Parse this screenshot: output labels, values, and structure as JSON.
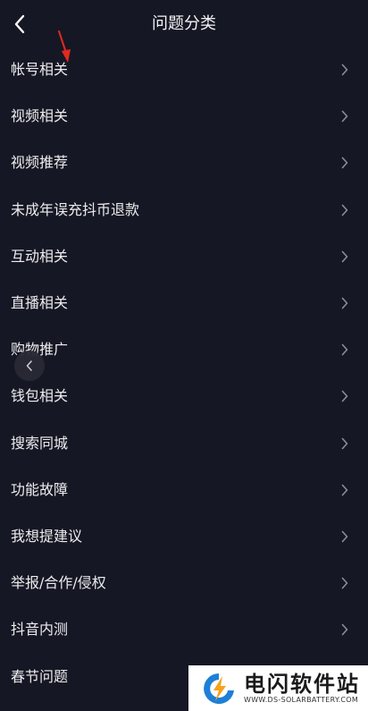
{
  "header": {
    "title": "问题分类"
  },
  "categories": [
    {
      "label": "帐号相关"
    },
    {
      "label": "视频相关"
    },
    {
      "label": "视频推荐"
    },
    {
      "label": "未成年误充抖币退款"
    },
    {
      "label": "互动相关"
    },
    {
      "label": "直播相关"
    },
    {
      "label": "购物推广"
    },
    {
      "label": "钱包相关"
    },
    {
      "label": "搜索同城"
    },
    {
      "label": "功能故障"
    },
    {
      "label": "我想提建议"
    },
    {
      "label": "举报/合作/侵权"
    },
    {
      "label": "抖音内测"
    },
    {
      "label": "春节问题"
    }
  ],
  "watermark": {
    "name": "电闪软件站",
    "url": "WWW.DS-SOLARBATTERY.COM"
  },
  "colors": {
    "background": "#161724",
    "text": "#ececee",
    "chevron": "#8c8d96",
    "annotation_arrow": "#e02a1f",
    "logo_blue": "#1e7fd6",
    "logo_orange": "#f5a21c"
  }
}
